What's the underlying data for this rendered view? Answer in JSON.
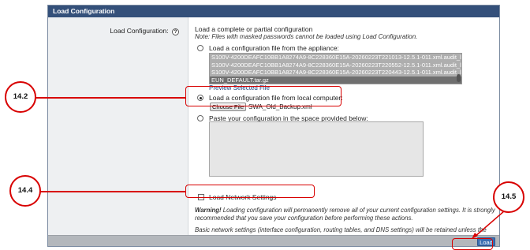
{
  "panel": {
    "title": "Load Configuration",
    "field_label": "Load Configuration:",
    "help_glyph": "?"
  },
  "intro": {
    "title": "Load a complete or partial configuration",
    "note": "Note: Files with masked passwords cannot be loaded using Load Configuration."
  },
  "options": {
    "appliance_label": "Load a configuration file from the appliance:",
    "appliance_files": [
      "S100V-4200DEAFC10BB1A8274A9-8C228360E15A-20260223T221013-12.5.1-011.xml.audit_l",
      "S100V-4200DEAFC10BB1A8274A9-8C228360E15A-20260223T220552-12.5.1-011.xml.audit_l",
      "S100V-4200DEAFC10BB1A8274A9-8C228360E15A-20260223T220443-12.5.1-011.xml.audit_l",
      "EUN_DEFAULT.tar.gz"
    ],
    "preview_link": "Preview Selected File",
    "local_label": "Load a configuration file from local computer:",
    "choose_file_label": "Choose File",
    "chosen_file": "SWA_Old_Backup.xml",
    "paste_label": "Paste your configuration in the space provided below:",
    "paste_value": "",
    "network_label": "Load Network Settings"
  },
  "warning": {
    "prefix": "Warning!",
    "text": " Loading configuration will permanently remove all of your current configuration settings. It is strongly recommended that you save your configuration before performing these actions."
  },
  "basic_note": "Basic network settings (interface configuration, routing tables, and DNS settings) will be retained unless the option to load network settings is selected.",
  "footer": {
    "load_label": "Load"
  },
  "callouts": {
    "c1": "14.2",
    "c2": "14.4",
    "c3": "14.5"
  },
  "colors": {
    "header_bg": "#34507a",
    "button_blue": "#3b6fb2",
    "callout_red": "#d80000"
  }
}
